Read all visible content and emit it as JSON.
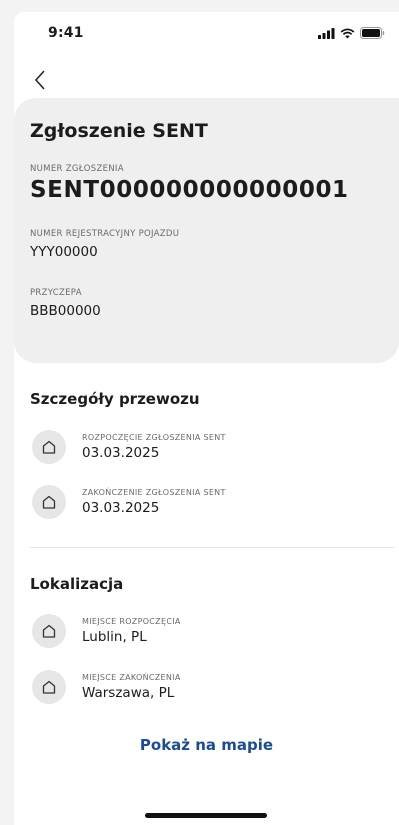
{
  "status_bar": {
    "time": "9:41"
  },
  "card": {
    "title": "Zgłoszenie SENT",
    "number_caption": "NUMER ZGŁOSZENIA",
    "number_value": "SENT000000000000001",
    "plate_caption": "NUMER REJESTRACYJNY POJAZDU",
    "plate_value": "YYY00000",
    "trailer_caption": "PRZYCZEPA",
    "trailer_value": "BBB00000"
  },
  "transport": {
    "title": "Szczegóły przewozu",
    "items": [
      {
        "caption": "ROZPOCZĘCIE ZGŁOSZENIA SENT",
        "value": "03.03.2025",
        "icon": "home-icon"
      },
      {
        "caption": "ZAKOŃCZENIE ZGŁOSZENIA SENT",
        "value": "03.03.2025",
        "icon": "home-icon"
      }
    ]
  },
  "location": {
    "title": "Lokalizacja",
    "items": [
      {
        "caption": "MIEJSCE ROZPOCZĘCIA",
        "value": "Lublin, PL",
        "icon": "home-icon"
      },
      {
        "caption": "MIEJSCE ZAKOŃCZENIA",
        "value": "Warszawa, PL",
        "icon": "home-icon"
      }
    ]
  },
  "actions": {
    "show_on_map": "Pokaż na mapie"
  },
  "colors": {
    "accent": "#1d4d8c",
    "card_bg": "#efefef",
    "icon_bg": "#e6e6e6"
  }
}
